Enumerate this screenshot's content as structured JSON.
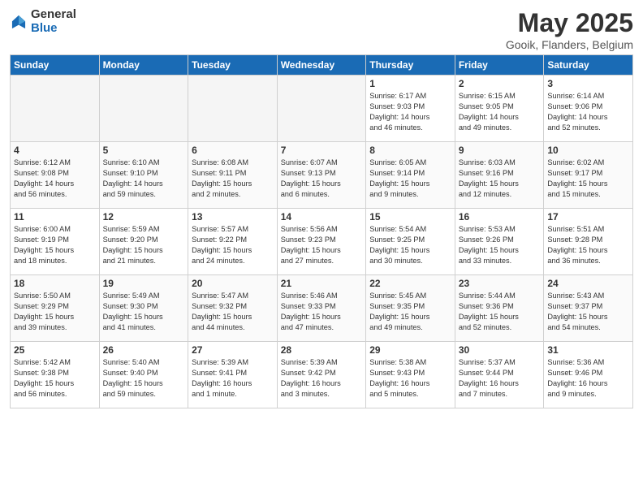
{
  "logo": {
    "general": "General",
    "blue": "Blue"
  },
  "title": "May 2025",
  "subtitle": "Gooik, Flanders, Belgium",
  "headers": [
    "Sunday",
    "Monday",
    "Tuesday",
    "Wednesday",
    "Thursday",
    "Friday",
    "Saturday"
  ],
  "weeks": [
    [
      {
        "date": "",
        "info": ""
      },
      {
        "date": "",
        "info": ""
      },
      {
        "date": "",
        "info": ""
      },
      {
        "date": "",
        "info": ""
      },
      {
        "date": "1",
        "info": "Sunrise: 6:17 AM\nSunset: 9:03 PM\nDaylight: 14 hours\nand 46 minutes."
      },
      {
        "date": "2",
        "info": "Sunrise: 6:15 AM\nSunset: 9:05 PM\nDaylight: 14 hours\nand 49 minutes."
      },
      {
        "date": "3",
        "info": "Sunrise: 6:14 AM\nSunset: 9:06 PM\nDaylight: 14 hours\nand 52 minutes."
      }
    ],
    [
      {
        "date": "4",
        "info": "Sunrise: 6:12 AM\nSunset: 9:08 PM\nDaylight: 14 hours\nand 56 minutes."
      },
      {
        "date": "5",
        "info": "Sunrise: 6:10 AM\nSunset: 9:10 PM\nDaylight: 14 hours\nand 59 minutes."
      },
      {
        "date": "6",
        "info": "Sunrise: 6:08 AM\nSunset: 9:11 PM\nDaylight: 15 hours\nand 2 minutes."
      },
      {
        "date": "7",
        "info": "Sunrise: 6:07 AM\nSunset: 9:13 PM\nDaylight: 15 hours\nand 6 minutes."
      },
      {
        "date": "8",
        "info": "Sunrise: 6:05 AM\nSunset: 9:14 PM\nDaylight: 15 hours\nand 9 minutes."
      },
      {
        "date": "9",
        "info": "Sunrise: 6:03 AM\nSunset: 9:16 PM\nDaylight: 15 hours\nand 12 minutes."
      },
      {
        "date": "10",
        "info": "Sunrise: 6:02 AM\nSunset: 9:17 PM\nDaylight: 15 hours\nand 15 minutes."
      }
    ],
    [
      {
        "date": "11",
        "info": "Sunrise: 6:00 AM\nSunset: 9:19 PM\nDaylight: 15 hours\nand 18 minutes."
      },
      {
        "date": "12",
        "info": "Sunrise: 5:59 AM\nSunset: 9:20 PM\nDaylight: 15 hours\nand 21 minutes."
      },
      {
        "date": "13",
        "info": "Sunrise: 5:57 AM\nSunset: 9:22 PM\nDaylight: 15 hours\nand 24 minutes."
      },
      {
        "date": "14",
        "info": "Sunrise: 5:56 AM\nSunset: 9:23 PM\nDaylight: 15 hours\nand 27 minutes."
      },
      {
        "date": "15",
        "info": "Sunrise: 5:54 AM\nSunset: 9:25 PM\nDaylight: 15 hours\nand 30 minutes."
      },
      {
        "date": "16",
        "info": "Sunrise: 5:53 AM\nSunset: 9:26 PM\nDaylight: 15 hours\nand 33 minutes."
      },
      {
        "date": "17",
        "info": "Sunrise: 5:51 AM\nSunset: 9:28 PM\nDaylight: 15 hours\nand 36 minutes."
      }
    ],
    [
      {
        "date": "18",
        "info": "Sunrise: 5:50 AM\nSunset: 9:29 PM\nDaylight: 15 hours\nand 39 minutes."
      },
      {
        "date": "19",
        "info": "Sunrise: 5:49 AM\nSunset: 9:30 PM\nDaylight: 15 hours\nand 41 minutes."
      },
      {
        "date": "20",
        "info": "Sunrise: 5:47 AM\nSunset: 9:32 PM\nDaylight: 15 hours\nand 44 minutes."
      },
      {
        "date": "21",
        "info": "Sunrise: 5:46 AM\nSunset: 9:33 PM\nDaylight: 15 hours\nand 47 minutes."
      },
      {
        "date": "22",
        "info": "Sunrise: 5:45 AM\nSunset: 9:35 PM\nDaylight: 15 hours\nand 49 minutes."
      },
      {
        "date": "23",
        "info": "Sunrise: 5:44 AM\nSunset: 9:36 PM\nDaylight: 15 hours\nand 52 minutes."
      },
      {
        "date": "24",
        "info": "Sunrise: 5:43 AM\nSunset: 9:37 PM\nDaylight: 15 hours\nand 54 minutes."
      }
    ],
    [
      {
        "date": "25",
        "info": "Sunrise: 5:42 AM\nSunset: 9:38 PM\nDaylight: 15 hours\nand 56 minutes."
      },
      {
        "date": "26",
        "info": "Sunrise: 5:40 AM\nSunset: 9:40 PM\nDaylight: 15 hours\nand 59 minutes."
      },
      {
        "date": "27",
        "info": "Sunrise: 5:39 AM\nSunset: 9:41 PM\nDaylight: 16 hours\nand 1 minute."
      },
      {
        "date": "28",
        "info": "Sunrise: 5:39 AM\nSunset: 9:42 PM\nDaylight: 16 hours\nand 3 minutes."
      },
      {
        "date": "29",
        "info": "Sunrise: 5:38 AM\nSunset: 9:43 PM\nDaylight: 16 hours\nand 5 minutes."
      },
      {
        "date": "30",
        "info": "Sunrise: 5:37 AM\nSunset: 9:44 PM\nDaylight: 16 hours\nand 7 minutes."
      },
      {
        "date": "31",
        "info": "Sunrise: 5:36 AM\nSunset: 9:46 PM\nDaylight: 16 hours\nand 9 minutes."
      }
    ]
  ]
}
